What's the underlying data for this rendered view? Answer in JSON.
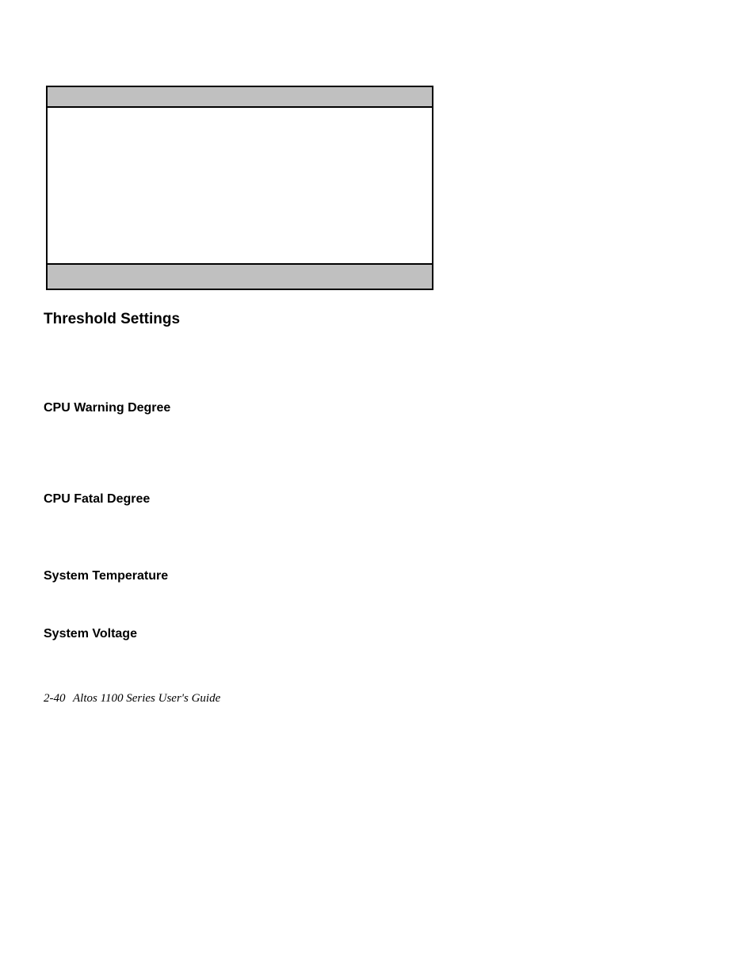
{
  "headings": {
    "threshold_settings": "Threshold Settings",
    "cpu_warning_degree": "CPU Warning Degree",
    "cpu_fatal_degree": "CPU Fatal Degree",
    "system_temperature": "System Temperature",
    "system_voltage": "System Voltage"
  },
  "footer": {
    "page_number": "2-40",
    "title": "Altos 1100 Series User's Guide"
  }
}
